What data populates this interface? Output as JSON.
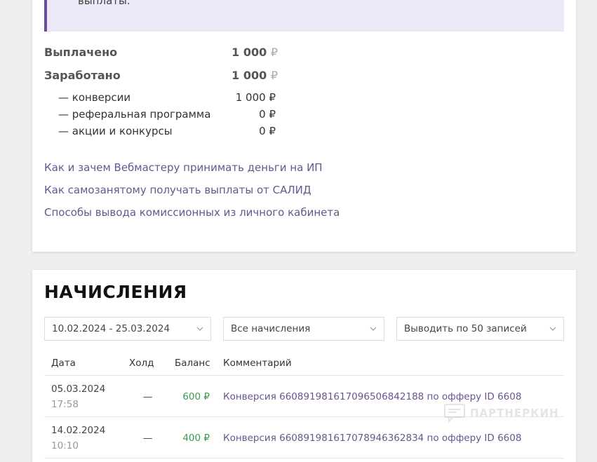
{
  "notice": {
    "text": "выплаты."
  },
  "summary": {
    "paid_label": "Выплачено",
    "paid_value": "1 000",
    "earned_label": "Заработано",
    "earned_value": "1 000",
    "currency": "₽"
  },
  "breakdown": [
    {
      "label": "— конверсии",
      "value": "1 000"
    },
    {
      "label": "— реферальная программа",
      "value": "0"
    },
    {
      "label": "— акции и конкурсы",
      "value": "0"
    }
  ],
  "links": [
    "Как и зачем Вебмастеру принимать деньги на ИП",
    "Как самозанятому получать выплаты от САЛИД",
    "Способы вывода комиссионных из личного кабинета"
  ],
  "accruals": {
    "title": "НАЧИСЛЕНИЯ",
    "date_range": "10.02.2024 - 25.03.2024",
    "type_filter": "Все начисления",
    "page_size": "Выводить по 50 записей",
    "columns": {
      "date": "Дата",
      "hold": "Холд",
      "balance": "Баланс",
      "comment": "Комментарий"
    },
    "rows": [
      {
        "date": "05.03.2024",
        "time": "17:58",
        "hold": "—",
        "balance": "600 ₽",
        "comment": "Конверсия 660891981617096506842188 по офферу ID 6608"
      },
      {
        "date": "14.02.2024",
        "time": "10:10",
        "hold": "—",
        "balance": "400 ₽",
        "comment": "Конверсия 660891981617078946362834 по офферу ID 6608"
      }
    ]
  },
  "watermark": {
    "text": "ПАРТНЕРКИН"
  },
  "colors": {
    "accent": "#6b548f",
    "notice_bg": "#ece8f7",
    "notice_border": "#6a4d9c",
    "positive": "#3c9a50"
  }
}
